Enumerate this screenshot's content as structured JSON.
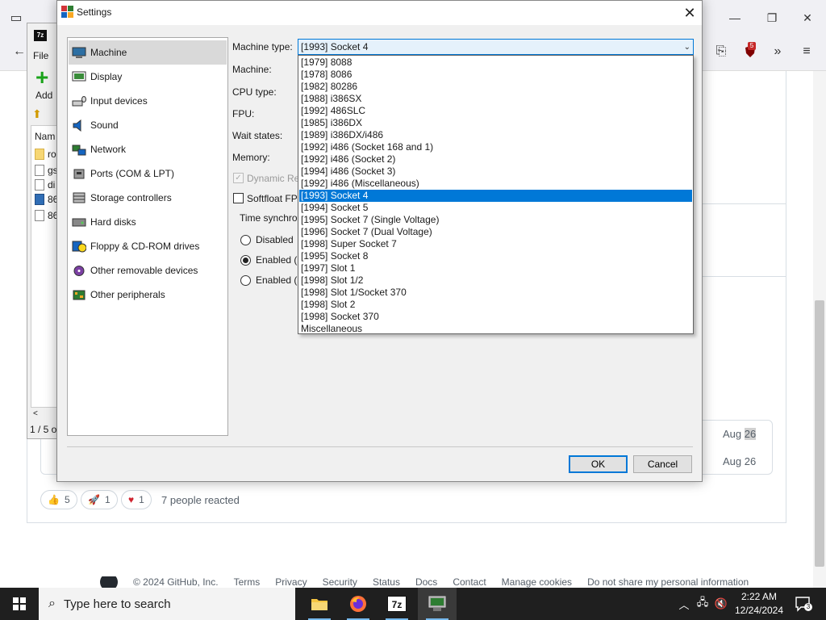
{
  "browser": {
    "ext_badge": "5",
    "comment": {
      "date1": "Aug",
      "date1_hl": "26",
      "date2": "Aug 26",
      "reactions": [
        {
          "icon": "thumbs-up",
          "count": "5"
        },
        {
          "icon": "rocket",
          "count": "1"
        },
        {
          "icon": "heart",
          "count": "1"
        }
      ],
      "reacted_text": "7 people reacted"
    },
    "footer": {
      "copyright": "© 2024 GitHub, Inc.",
      "links": [
        "Terms",
        "Privacy",
        "Security",
        "Status",
        "Docs",
        "Contact",
        "Manage cookies",
        "Do not share my personal information"
      ]
    }
  },
  "zip_window": {
    "title_icon": "7z",
    "title_partial": "7",
    "menu_file": "File",
    "add_label": "Add",
    "column_name": "Nam",
    "rows": [
      {
        "name": "ro",
        "type": "folder"
      },
      {
        "name": "gs",
        "type": "file"
      },
      {
        "name": "di",
        "type": "file"
      },
      {
        "name": "86",
        "type": "exe"
      },
      {
        "name": "86",
        "type": "file"
      }
    ],
    "scroll_left": "<",
    "status": "1 / 5 o"
  },
  "dialog": {
    "title": "Settings",
    "categories": [
      {
        "label": "Machine",
        "icon": "machine-icon",
        "selected": true
      },
      {
        "label": "Display",
        "icon": "display-icon"
      },
      {
        "label": "Input devices",
        "icon": "input-devices-icon"
      },
      {
        "label": "Sound",
        "icon": "sound-icon"
      },
      {
        "label": "Network",
        "icon": "network-icon"
      },
      {
        "label": "Ports (COM & LPT)",
        "icon": "ports-icon"
      },
      {
        "label": "Storage controllers",
        "icon": "storage-controllers-icon"
      },
      {
        "label": "Hard disks",
        "icon": "hard-disk-icon"
      },
      {
        "label": "Floppy & CD-ROM drives",
        "icon": "floppy-cdrom-icon"
      },
      {
        "label": "Other removable devices",
        "icon": "removable-devices-icon"
      },
      {
        "label": "Other peripherals",
        "icon": "peripherals-icon"
      }
    ],
    "labels": {
      "machine_type": "Machine type:",
      "machine": "Machine:",
      "cpu_type": "CPU type:",
      "fpu": "FPU:",
      "wait_states": "Wait states:",
      "memory": "Memory:"
    },
    "machine_type_value": "[1993] Socket 4",
    "machine_type_options": [
      "[1979] 8088",
      "[1978] 8086",
      "[1982] 80286",
      "[1988] i386SX",
      "[1992] 486SLC",
      "[1985] i386DX",
      "[1989] i386DX/i486",
      "[1992] i486 (Socket 168 and 1)",
      "[1992] i486 (Socket 2)",
      "[1994] i486 (Socket 3)",
      "[1992] i486 (Miscellaneous)",
      "[1993] Socket 4",
      "[1994] Socket 5",
      "[1995] Socket 7 (Single Voltage)",
      "[1996] Socket 7 (Dual Voltage)",
      "[1998] Super Socket 7",
      "[1995] Socket 8",
      "[1997] Slot 1",
      "[1998] Slot 1/2",
      "[1998] Slot 1/Socket 370",
      "[1998] Slot 2",
      "[1998] Socket 370",
      "Miscellaneous"
    ],
    "highlighted_index": 11,
    "dynamic_recompiler_label": "Dynamic Re",
    "softfloat_label": "Softfloat FP",
    "time_sync_label": "Time synchro",
    "time_sync_options": [
      {
        "label": "Disabled",
        "checked": false
      },
      {
        "label": "Enabled (l",
        "checked": true
      },
      {
        "label": "Enabled (l",
        "checked": false
      }
    ],
    "ok_label": "OK",
    "cancel_label": "Cancel"
  },
  "taskbar": {
    "search_placeholder": "Type here to search",
    "apps": [
      "file-explorer-icon",
      "firefox-icon",
      "7zip-icon",
      "86box-icon"
    ],
    "app_7zip_label": "7z",
    "clock_time": "2:22 AM",
    "clock_date": "12/24/2024",
    "notification_count": "3"
  },
  "colors": {
    "accent": "#0078d7",
    "taskbar": "#1f1f1f",
    "dialog_bg": "#f0f0f0"
  }
}
